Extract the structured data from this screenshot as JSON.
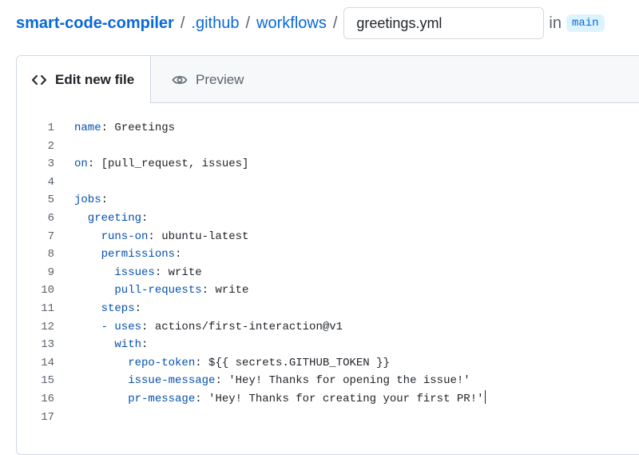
{
  "breadcrumb": {
    "repo": "smart-code-compiler",
    "sep1": "/",
    "folder1": ".github",
    "sep2": "/",
    "folder2": "workflows",
    "sep3": "/"
  },
  "filename_input": {
    "value": "greetings.yml"
  },
  "branch": {
    "in_label": "in",
    "name": "main"
  },
  "tabs": {
    "edit_label": "Edit new file",
    "preview_label": "Preview"
  },
  "icons": {
    "edit_tab": "code-icon",
    "preview_tab": "eye-icon"
  },
  "editor": {
    "lines": [
      {
        "n": "1",
        "key": "name",
        "rest": ": Greetings"
      },
      {
        "n": "2",
        "key": "",
        "rest": ""
      },
      {
        "n": "3",
        "key": "on",
        "rest": ": [pull_request, issues]"
      },
      {
        "n": "4",
        "key": "",
        "rest": ""
      },
      {
        "n": "5",
        "key": "jobs",
        "rest": ":"
      },
      {
        "n": "6",
        "key": "  greeting",
        "rest": ":"
      },
      {
        "n": "7",
        "key": "    runs-on",
        "rest": ": ubuntu-latest"
      },
      {
        "n": "8",
        "key": "    permissions",
        "rest": ":"
      },
      {
        "n": "9",
        "key": "      issues",
        "rest": ": write"
      },
      {
        "n": "10",
        "key": "      pull-requests",
        "rest": ": write"
      },
      {
        "n": "11",
        "key": "    steps",
        "rest": ":"
      },
      {
        "n": "12",
        "key": "    - uses",
        "rest": ": actions/first-interaction@v1"
      },
      {
        "n": "13",
        "key": "      with",
        "rest": ":"
      },
      {
        "n": "14",
        "key": "        repo-token",
        "rest": ": ${{ secrets.GITHUB_TOKEN }}"
      },
      {
        "n": "15",
        "key": "        issue-message",
        "rest": ": 'Hey! Thanks for opening the issue!'"
      },
      {
        "n": "16",
        "key": "        pr-message",
        "rest": ": 'Hey! Thanks for creating your first PR!'"
      },
      {
        "n": "17",
        "key": "",
        "rest": ""
      }
    ]
  },
  "colors": {
    "link": "#0969da",
    "yaml_key": "#0550ae",
    "badge_bg": "#ddf4ff"
  }
}
